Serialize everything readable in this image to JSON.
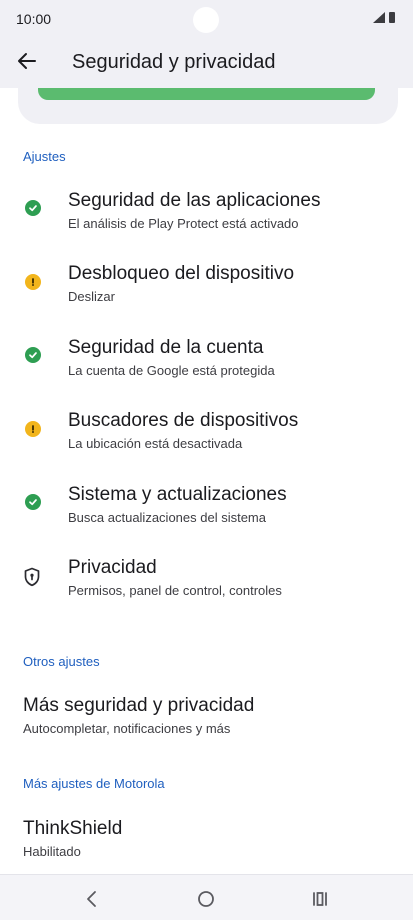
{
  "status_bar": {
    "time": "10:00"
  },
  "app_bar": {
    "title": "Seguridad y privacidad"
  },
  "sections": {
    "ajustes": "Ajustes",
    "otros": "Otros ajustes",
    "motorola": "Más ajustes de Motorola"
  },
  "items": [
    {
      "title": "Seguridad de las aplicaciones",
      "subtitle": "El análisis de Play Protect está activado",
      "status": "ok",
      "icon": "check-circle-icon"
    },
    {
      "title": "Desbloqueo del dispositivo",
      "subtitle": "Deslizar",
      "status": "warning",
      "icon": "warning-circle-icon"
    },
    {
      "title": "Seguridad de la cuenta",
      "subtitle": "La cuenta de Google está protegida",
      "status": "ok",
      "icon": "check-circle-icon"
    },
    {
      "title": "Buscadores de dispositivos",
      "subtitle": "La ubicación está desactivada",
      "status": "warning",
      "icon": "warning-circle-icon"
    },
    {
      "title": "Sistema y actualizaciones",
      "subtitle": "Busca actualizaciones del sistema",
      "status": "ok",
      "icon": "check-circle-icon"
    },
    {
      "title": "Privacidad",
      "subtitle": "Permisos, panel de control, controles",
      "status": "neutral",
      "icon": "shield-icon"
    }
  ],
  "more_item": {
    "title": "Más seguridad y privacidad",
    "subtitle": "Autocompletar, notificaciones y más"
  },
  "motorola_item": {
    "title": "ThinkShield",
    "subtitle": "Habilitado"
  },
  "colors": {
    "ok": "#2e9e52",
    "warning": "#f2b51c",
    "section_header": "#1f5fbf",
    "top_tint": "#f0f0f5"
  }
}
